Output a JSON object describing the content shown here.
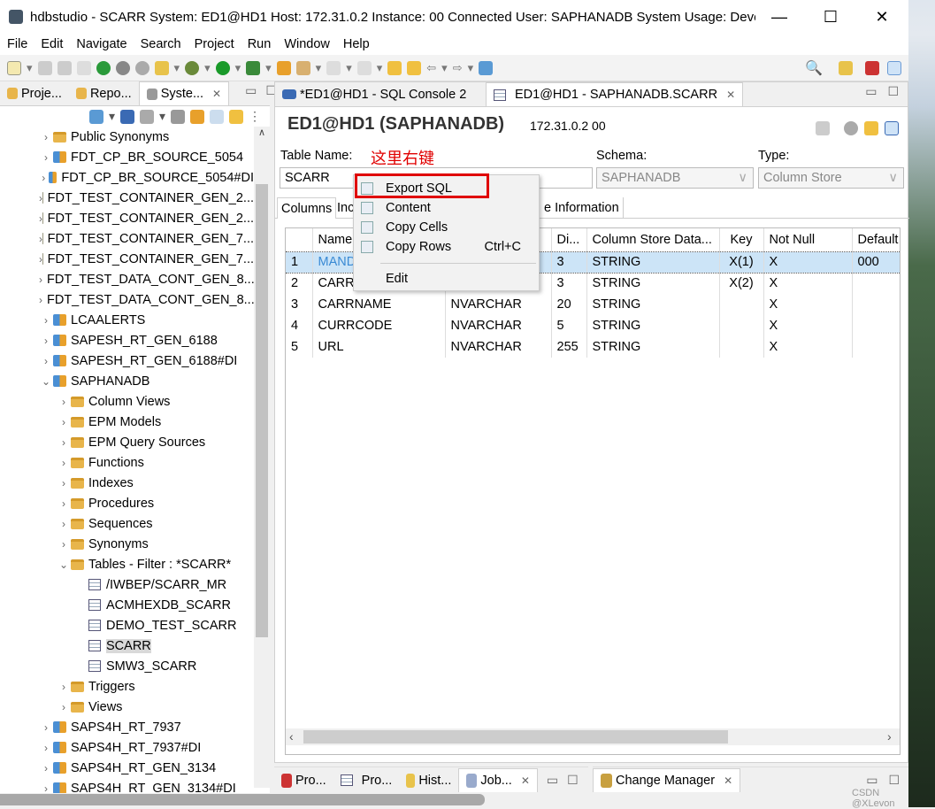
{
  "window": {
    "title": "hdbstudio - SCARR System: ED1@HD1 Host: 172.31.0.2 Instance: 00 Connected User: SAPHANADB System Usage: Develop...",
    "minimize": "—",
    "maximize": "☐",
    "close": "✕"
  },
  "menu": [
    "File",
    "Edit",
    "Navigate",
    "Search",
    "Project",
    "Run",
    "Window",
    "Help"
  ],
  "left_tabs": [
    {
      "label": "Proje..."
    },
    {
      "label": "Repo..."
    },
    {
      "label": "Syste..."
    }
  ],
  "tree": [
    {
      "label": "Public Synonyms",
      "level": 1,
      "type": "folder",
      "expanded": false
    },
    {
      "label": "FDT_CP_BR_SOURCE_5054",
      "level": 1,
      "type": "schema",
      "expanded": false
    },
    {
      "label": "FDT_CP_BR_SOURCE_5054#DI",
      "level": 1,
      "type": "schema",
      "expanded": false
    },
    {
      "label": "FDT_TEST_CONTAINER_GEN_2...",
      "level": 1,
      "type": "schema",
      "expanded": false
    },
    {
      "label": "FDT_TEST_CONTAINER_GEN_2...",
      "level": 1,
      "type": "schema",
      "expanded": false
    },
    {
      "label": "FDT_TEST_CONTAINER_GEN_7...",
      "level": 1,
      "type": "schema",
      "expanded": false
    },
    {
      "label": "FDT_TEST_CONTAINER_GEN_7...",
      "level": 1,
      "type": "schema",
      "expanded": false
    },
    {
      "label": "FDT_TEST_DATA_CONT_GEN_8...",
      "level": 1,
      "type": "schema",
      "expanded": false
    },
    {
      "label": "FDT_TEST_DATA_CONT_GEN_8...",
      "level": 1,
      "type": "schema",
      "expanded": false
    },
    {
      "label": "LCAALERTS",
      "level": 1,
      "type": "schema",
      "expanded": false
    },
    {
      "label": "SAPESH_RT_GEN_6188",
      "level": 1,
      "type": "schema",
      "expanded": false
    },
    {
      "label": "SAPESH_RT_GEN_6188#DI",
      "level": 1,
      "type": "schema",
      "expanded": false
    },
    {
      "label": "SAPHANADB",
      "level": 1,
      "type": "schema",
      "expanded": true
    },
    {
      "label": "Column Views",
      "level": 2,
      "type": "folder",
      "expanded": false
    },
    {
      "label": "EPM Models",
      "level": 2,
      "type": "folder",
      "expanded": false
    },
    {
      "label": "EPM Query Sources",
      "level": 2,
      "type": "folder",
      "expanded": false
    },
    {
      "label": "Functions",
      "level": 2,
      "type": "folder",
      "expanded": false
    },
    {
      "label": "Indexes",
      "level": 2,
      "type": "folder",
      "expanded": false
    },
    {
      "label": "Procedures",
      "level": 2,
      "type": "folder",
      "expanded": false
    },
    {
      "label": "Sequences",
      "level": 2,
      "type": "folder",
      "expanded": false
    },
    {
      "label": "Synonyms",
      "level": 2,
      "type": "folder",
      "expanded": false
    },
    {
      "label": "Tables - Filter : *SCARR*",
      "level": 2,
      "type": "folder",
      "expanded": true
    },
    {
      "label": "/IWBEP/SCARR_MR",
      "level": 3,
      "type": "table"
    },
    {
      "label": "ACMHEXDB_SCARR",
      "level": 3,
      "type": "table"
    },
    {
      "label": "DEMO_TEST_SCARR",
      "level": 3,
      "type": "table"
    },
    {
      "label": "SCARR",
      "level": 3,
      "type": "table",
      "selected": true
    },
    {
      "label": "SMW3_SCARR",
      "level": 3,
      "type": "table"
    },
    {
      "label": "Triggers",
      "level": 2,
      "type": "folder",
      "expanded": false
    },
    {
      "label": "Views",
      "level": 2,
      "type": "folder",
      "expanded": false
    },
    {
      "label": "SAPS4H_RT_7937",
      "level": 1,
      "type": "schema",
      "expanded": false
    },
    {
      "label": "SAPS4H_RT_7937#DI",
      "level": 1,
      "type": "schema",
      "expanded": false
    },
    {
      "label": "SAPS4H_RT_GEN_3134",
      "level": 1,
      "type": "schema",
      "expanded": false
    },
    {
      "label": "SAPS4H_RT_GEN_3134#DI",
      "level": 1,
      "type": "schema",
      "expanded": false
    }
  ],
  "editor_tabs": [
    {
      "label": "*ED1@HD1 - SQL Console 2"
    },
    {
      "label": "ED1@HD1 - SAPHANADB.SCARR",
      "active": true
    }
  ],
  "editor": {
    "heading": "ED1@HD1 (SAPHANADB)",
    "host": "172.31.0.2 00",
    "table_name_label": "Table Name:",
    "annotation": "这里右键",
    "annotation_color": "#e00000",
    "table_name_value": "SCARR",
    "schema_label": "Schema:",
    "schema_value": "SAPHANADB",
    "type_label": "Type:",
    "type_value": "Column Store",
    "subtabs": [
      "Columns",
      "Inc",
      "e Information"
    ]
  },
  "table": {
    "headers": [
      "",
      "Name",
      "",
      "Di...",
      "Column Store Data...",
      "Key",
      "Not Null",
      "Default"
    ],
    "rows": [
      [
        "1",
        "MAND",
        "",
        "3",
        "STRING",
        "X(1)",
        "X",
        "000"
      ],
      [
        "2",
        "CARRI",
        "",
        "3",
        "STRING",
        "X(2)",
        "X",
        ""
      ],
      [
        "3",
        "CARRNAME",
        "NVARCHAR",
        "20",
        "STRING",
        "",
        "X",
        ""
      ],
      [
        "4",
        "CURRCODE",
        "NVARCHAR",
        "5",
        "STRING",
        "",
        "X",
        ""
      ],
      [
        "5",
        "URL",
        "NVARCHAR",
        "255",
        "STRING",
        "",
        "X",
        ""
      ]
    ]
  },
  "context_menu": [
    {
      "label": "Export SQL",
      "icon": "export-icon",
      "highlighted": true
    },
    {
      "label": "Content",
      "icon": "content-icon"
    },
    {
      "label": "Copy Cells",
      "icon": "copy-icon"
    },
    {
      "label": "Copy Rows",
      "shortcut": "Ctrl+C",
      "icon": "copy-icon"
    },
    {
      "label": "Edit"
    }
  ],
  "bottom_tabs": [
    "Pro...",
    "Pro...",
    "Hist...",
    "Job..."
  ],
  "change_manager": "Change Manager",
  "watermark": "CSDN @XLevon"
}
